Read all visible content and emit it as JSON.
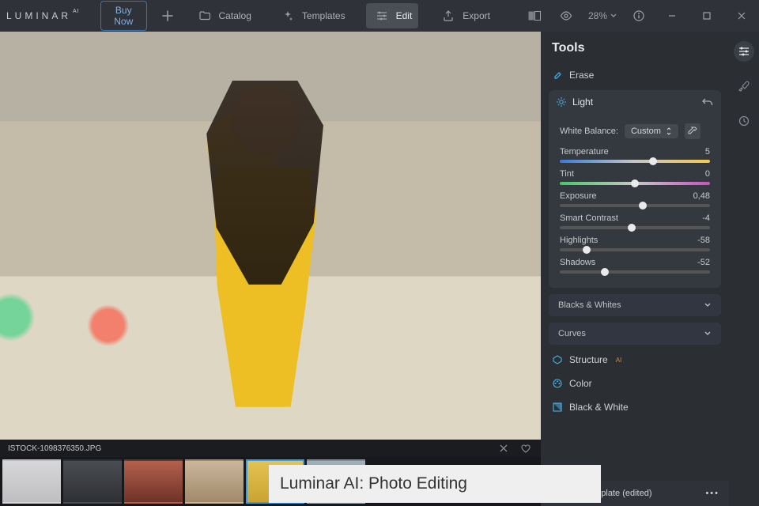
{
  "app": {
    "name": "LUMINAR",
    "name_suffix": "AI",
    "buy_label": "Buy Now"
  },
  "nav": {
    "catalog": "Catalog",
    "templates": "Templates",
    "edit": "Edit",
    "export": "Export"
  },
  "topright": {
    "zoom": "28%"
  },
  "file": {
    "name": "ISTOCK-1098376350.JPG"
  },
  "caption": "Luminar AI: Photo Editing",
  "tools": {
    "title": "Tools",
    "erase": "Erase",
    "light": {
      "title": "Light",
      "wb_label": "White Balance:",
      "wb_value": "Custom",
      "sliders": {
        "temperature": {
          "label": "Temperature",
          "value": "5",
          "pos": 62
        },
        "tint": {
          "label": "Tint",
          "value": "0",
          "pos": 50
        },
        "exposure": {
          "label": "Exposure",
          "value": "0,48",
          "pos": 55
        },
        "contrast": {
          "label": "Smart Contrast",
          "value": "-4",
          "pos": 48
        },
        "highlights": {
          "label": "Highlights",
          "value": "-58",
          "pos": 18
        },
        "shadows": {
          "label": "Shadows",
          "value": "-52",
          "pos": 30
        }
      },
      "bw": "Blacks & Whites",
      "curves": "Curves"
    },
    "structure": "Structure",
    "structure_badge": "AI",
    "color": "Color",
    "blackwhite": "Black & White"
  },
  "template": {
    "label": "My Template (edited)"
  }
}
